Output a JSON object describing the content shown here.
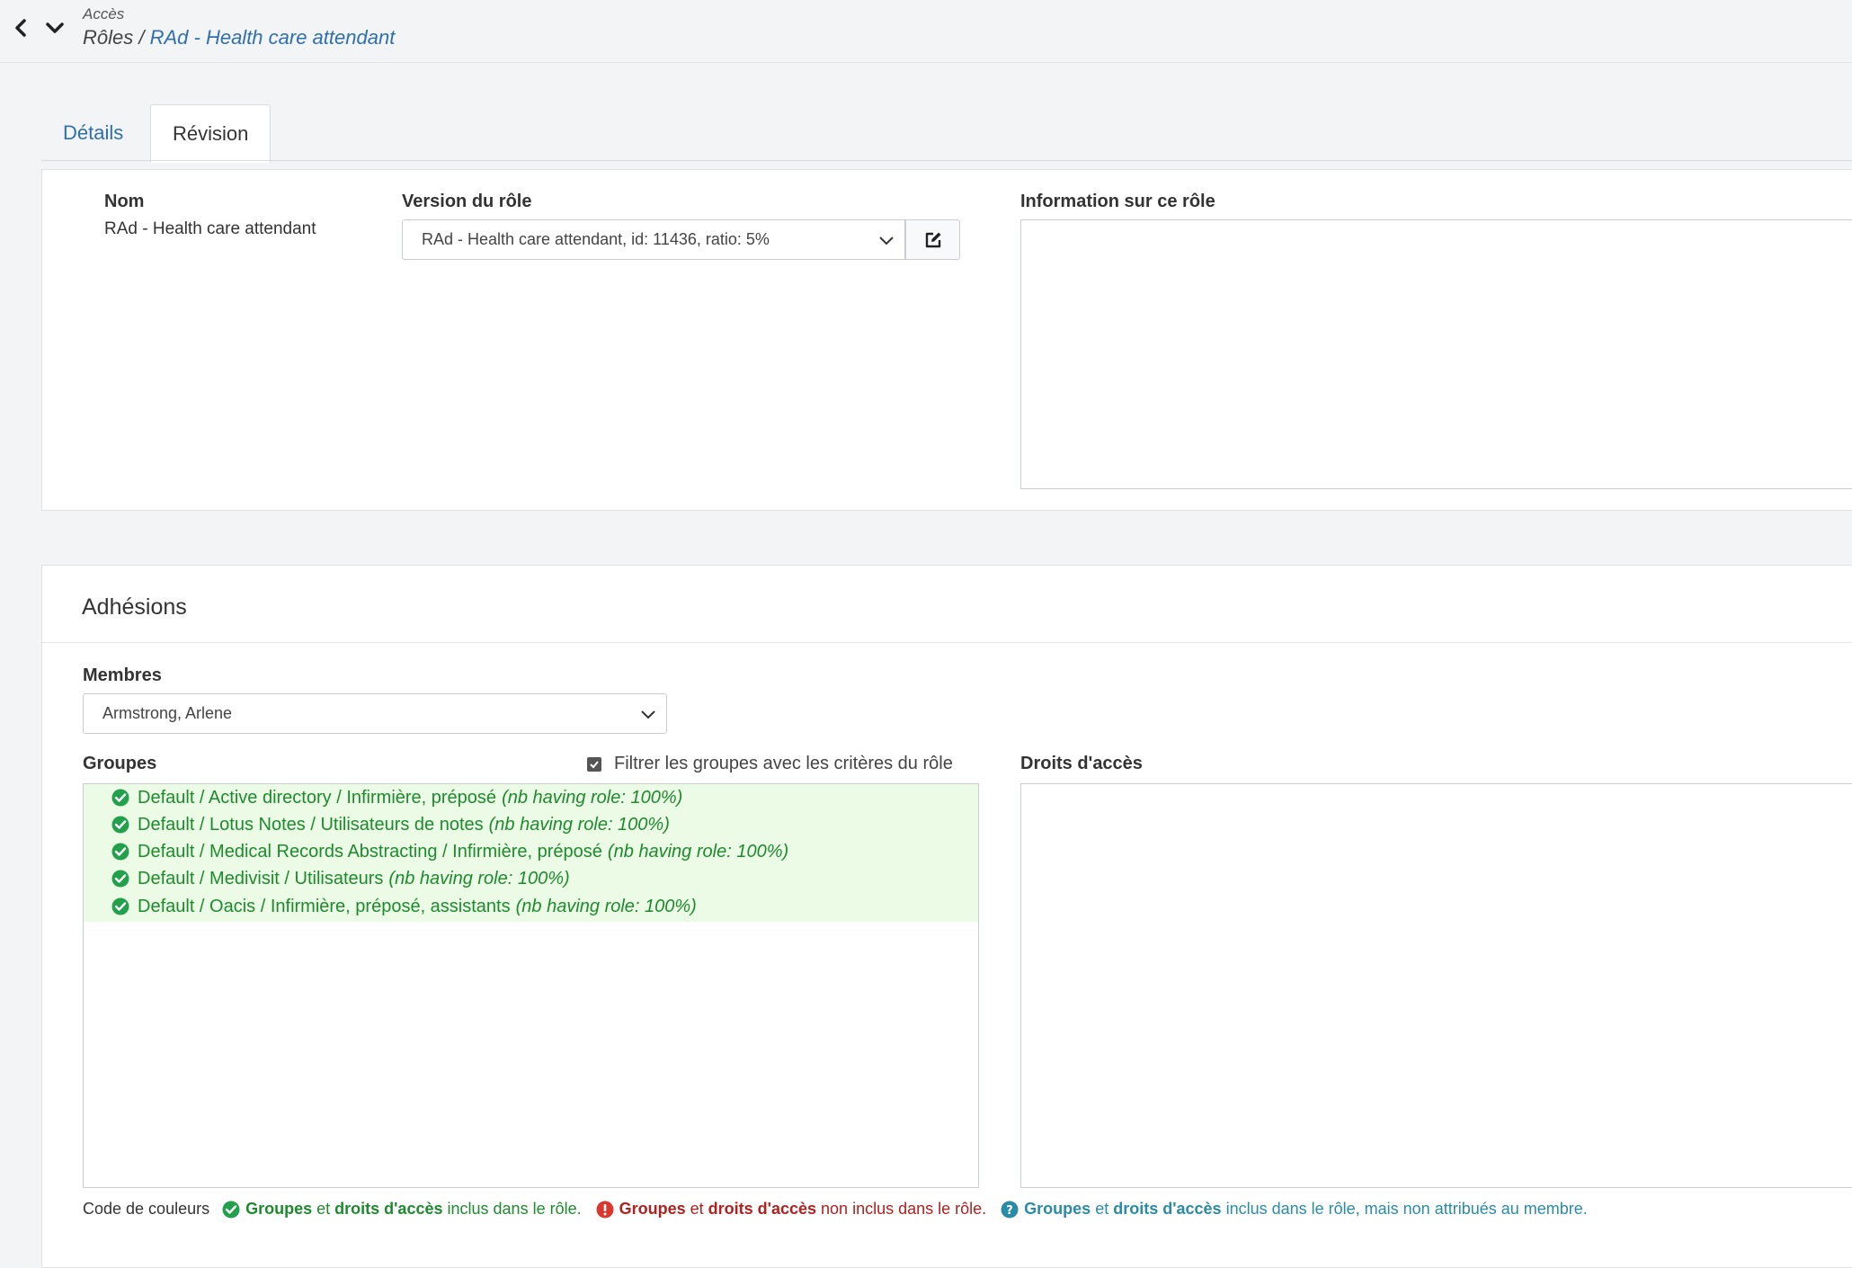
{
  "header": {
    "parent": "Accès",
    "breadcrumb_root": "Rôles",
    "breadcrumb_sep": " / ",
    "breadcrumb_current": "RAd - Health care attendant"
  },
  "tabs": [
    {
      "label": "Détails",
      "active": false
    },
    {
      "label": "Révision",
      "active": true
    }
  ],
  "role": {
    "name_label": "Nom",
    "name_value": "RAd - Health care attendant",
    "version_label": "Version du rôle",
    "version_value": "RAd - Health care attendant, id: 11436, ratio: 5%",
    "info_label": "Information sur ce rôle"
  },
  "memberships": {
    "title": "Adhésions",
    "members_label": "Membres",
    "member_selected": "Armstrong, Arlene",
    "groups_label": "Groupes",
    "filter_label": "Filtrer les groupes avec les critères du rôle",
    "filter_checked": true,
    "rights_label": "Droits d'accès",
    "groups": [
      {
        "name": "Default / Active directory / Infirmière, préposé",
        "note": "(nb having role: 100%)"
      },
      {
        "name": "Default / Lotus Notes / Utilisateurs de notes",
        "note": "(nb having role: 100%)"
      },
      {
        "name": "Default / Medical Records Abstracting / Infirmière, préposé",
        "note": "(nb having role: 100%)"
      },
      {
        "name": "Default / Medivisit / Utilisateurs",
        "note": "(nb having role: 100%)"
      },
      {
        "name": "Default / Oacis / Infirmière, préposé, assistants",
        "note": "(nb having role: 100%)"
      }
    ]
  },
  "legend": {
    "label": "Code de couleurs",
    "groups_word": "Groupes",
    "and_word": "et",
    "rights_word": "droits d'accès",
    "included": "inclus dans le rôle.",
    "not_included": "non inclus dans le rôle.",
    "included_not_assigned": "inclus dans le rôle, mais non attribués au membre.",
    "colors": {
      "green": "#1e8a2e",
      "red": "#b0211f",
      "blue": "#2a8ba6"
    }
  }
}
